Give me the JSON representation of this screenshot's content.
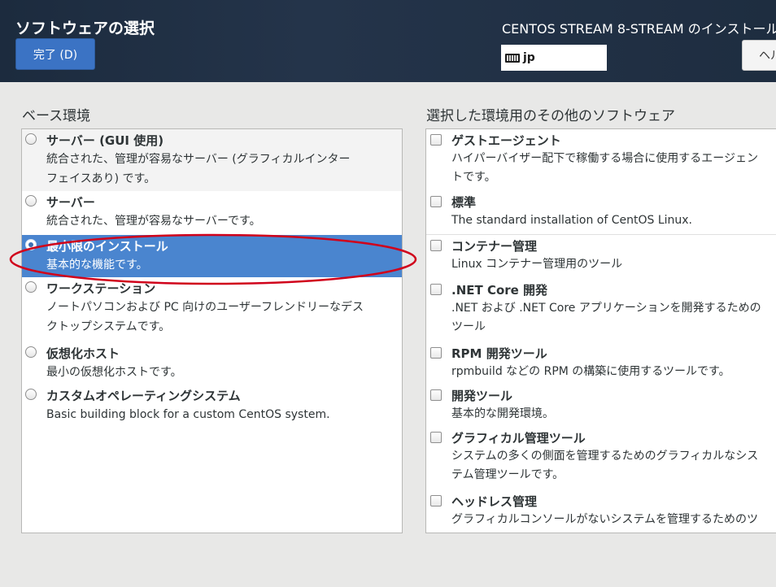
{
  "header": {
    "title": "ソフトウェアの選択",
    "done_button": "完了 (D)",
    "install_title": "CENTOS STREAM 8-STREAM のインストール",
    "keyboard_layout": "jp",
    "help_button": "ヘルプ"
  },
  "base_env": {
    "label": "ベース環境",
    "items": [
      {
        "name": "サーバー (GUI 使用)",
        "desc": "統合された、管理が容易なサーバー (グラフィカルインター\nフェイスあり) です。"
      },
      {
        "name": "サーバー",
        "desc": "統合された、管理が容易なサーバーです。"
      },
      {
        "name": "最小限のインストール",
        "desc": "基本的な機能です。",
        "selected": true
      },
      {
        "name": "ワークステーション",
        "desc": "ノートパソコンおよび PC 向けのユーザーフレンドリーなデス\nクトップシステムです。"
      },
      {
        "name": "仮想化ホスト",
        "desc": "最小の仮想化ホストです。"
      },
      {
        "name": "カスタムオペレーティングシステム",
        "desc": "Basic building block for a custom CentOS system."
      }
    ]
  },
  "addons": {
    "label": "選択した環境用のその他のソフトウェア",
    "items": [
      {
        "name": "ゲストエージェント",
        "desc": "ハイパーバイザー配下で稼働する場合に使用するエージェン\nトです。"
      },
      {
        "name": "標準",
        "desc": "The standard installation of CentOS Linux."
      },
      {
        "name": "コンテナー管理",
        "desc": "Linux コンテナー管理用のツール"
      },
      {
        "name": ".NET Core 開発",
        "desc": ".NET および .NET Core アプリケーションを開発するための\nツール"
      },
      {
        "name": "RPM 開発ツール",
        "desc": "rpmbuild などの RPM の構築に使用するツールです。"
      },
      {
        "name": "開発ツール",
        "desc": "基本的な開発環境。"
      },
      {
        "name": "グラフィカル管理ツール",
        "desc": "システムの多くの側面を管理するためのグラフィカルなシス\nテム管理ツールです。"
      },
      {
        "name": "ヘッドレス管理",
        "desc": "グラフィカルコンソールがないシステムを管理するためのツ"
      }
    ]
  },
  "colors": {
    "header_bg": "#1c2b3e",
    "accent": "#3b73c4",
    "selected_row": "#4a85cf",
    "annotation": "#d0021b"
  }
}
